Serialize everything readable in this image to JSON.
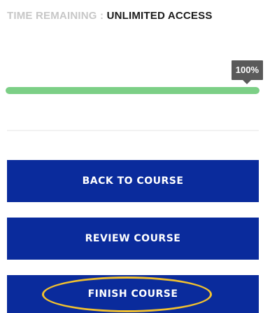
{
  "time_remaining": {
    "label": "TIME REMAINING : ",
    "value": "UNLIMITED ACCESS"
  },
  "progress": {
    "percent_label": "100%",
    "value": 1
  },
  "buttons": {
    "back_label": "BACK TO COURSE",
    "review_label": "REVIEW COURSE",
    "finish_label": "FINISH COURSE"
  },
  "colors": {
    "button_bg": "#0a2b9c",
    "progress_fill": "#7ccf86",
    "highlight": "#f2c12e"
  }
}
